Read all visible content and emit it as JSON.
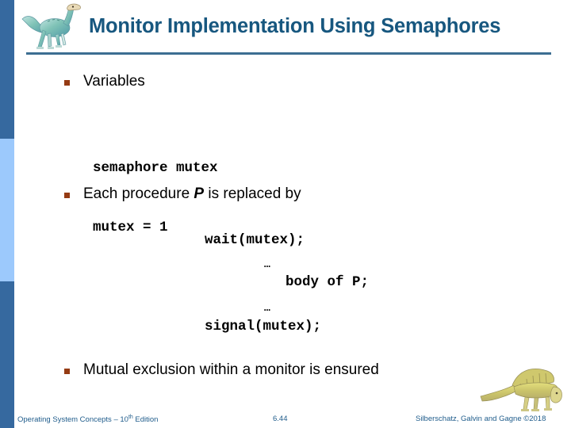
{
  "slide": {
    "title": "Monitor Implementation Using Semaphores",
    "title_color": "#17577f",
    "rule_color": "#3d6e92",
    "bullet_color": "#953b13",
    "stripe_colors": {
      "top": "#36699f",
      "middle": "#9cc9fc",
      "bottom": "#36699f"
    },
    "bullets": [
      {
        "label": "Variables"
      },
      {
        "label_before": "Each procedure ",
        "emph": "P",
        "label_after": " is replaced by"
      },
      {
        "label": "Mutual exclusion within a monitor is ensured"
      }
    ],
    "code_variables": [
      "semaphore mutex",
      "mutex = 1"
    ],
    "code_procedure": {
      "wait": "wait(mutex);",
      "dots_1": "…",
      "body": "body of P;",
      "dots_2": "…",
      "signal": "signal(mutex);"
    },
    "footer": {
      "left_main": "Operating System Concepts – 10",
      "left_sup": "th",
      "left_tail": " Edition",
      "center": "6.44",
      "right": "Silberschatz, Galvin and Gagne ©2018",
      "color": "#1f5c8b"
    },
    "icons": {
      "header_logo": "dinosaur-logo",
      "footer_logo": "dimetrodon-logo"
    }
  }
}
